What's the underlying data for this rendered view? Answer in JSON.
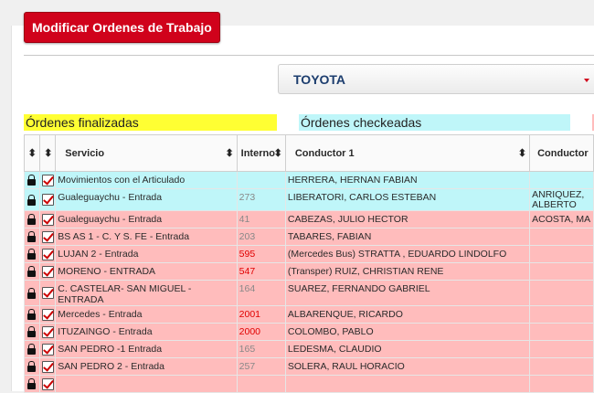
{
  "header": {
    "title": "Modificar Ordenes de Trabajo"
  },
  "filter": {
    "selected": "TOYOTA"
  },
  "legend": {
    "finalizadas": "Órdenes finalizadas",
    "finalizadas_color": "#ffff33",
    "checkeadas": "Órdenes checkeadas",
    "checkeadas_color": "#bff6f9",
    "third_color": "#ffbcbc"
  },
  "table": {
    "columns": {
      "servicio": "Servicio",
      "interno": "Interno",
      "conductor1": "Conductor 1",
      "conductor2": "Conductor"
    },
    "sort_glyph": "⬍",
    "rows": [
      {
        "servicio": "Movimientos con el Articulado",
        "interno": "",
        "conductor1": "HERRERA, HERNAN FABIAN",
        "conductor2": "",
        "status": "cyan",
        "interno_red": false
      },
      {
        "servicio": "Gualeguaychu - Entrada",
        "interno": "273",
        "conductor1": "LIBERATORI, CARLOS ESTEBAN",
        "conductor2": "ANRIQUEZ, ALBERTO",
        "status": "cyan",
        "interno_red": false
      },
      {
        "servicio": "Gualeguaychu - Entrada",
        "interno": "41",
        "conductor1": "CABEZAS, JULIO HECTOR",
        "conductor2": "ACOSTA, MA",
        "status": "red",
        "interno_red": false
      },
      {
        "servicio": "BS AS 1 - C. Y S. FE - Entrada",
        "interno": "203",
        "conductor1": "TABARES, FABIAN",
        "conductor2": "",
        "status": "red",
        "interno_red": false
      },
      {
        "servicio": "LUJAN 2 - Entrada",
        "interno": "595",
        "conductor1": "(Mercedes Bus) STRATTA , EDUARDO LINDOLFO",
        "conductor2": "",
        "status": "red",
        "interno_red": true
      },
      {
        "servicio": "MORENO - ENTRADA",
        "interno": "547",
        "conductor1": "(Transper) RUIZ, CHRISTIAN RENE",
        "conductor2": "",
        "status": "red",
        "interno_red": true
      },
      {
        "servicio": "C. CASTELAR- SAN MIGUEL - ENTRADA",
        "interno": "164",
        "conductor1": "SUAREZ, FERNANDO GABRIEL",
        "conductor2": "",
        "status": "red",
        "interno_red": false
      },
      {
        "servicio": "Mercedes - Entrada",
        "interno": "2001",
        "conductor1": "ALBARENQUE, RICARDO",
        "conductor2": "",
        "status": "red",
        "interno_red": true
      },
      {
        "servicio": "ITUZAINGO - Entrada",
        "interno": "2000",
        "conductor1": "COLOMBO, PABLO",
        "conductor2": "",
        "status": "red",
        "interno_red": true
      },
      {
        "servicio": "SAN PEDRO -1 Entrada",
        "interno": "165",
        "conductor1": "LEDESMA, CLAUDIO",
        "conductor2": "",
        "status": "red",
        "interno_red": false
      },
      {
        "servicio": "SAN PEDRO 2 - Entrada",
        "interno": "257",
        "conductor1": "SOLERA, RAUL HORACIO",
        "conductor2": "",
        "status": "red",
        "interno_red": false
      },
      {
        "servicio": "",
        "interno": "",
        "conductor1": "",
        "conductor2": "",
        "status": "red",
        "interno_red": false
      }
    ]
  }
}
